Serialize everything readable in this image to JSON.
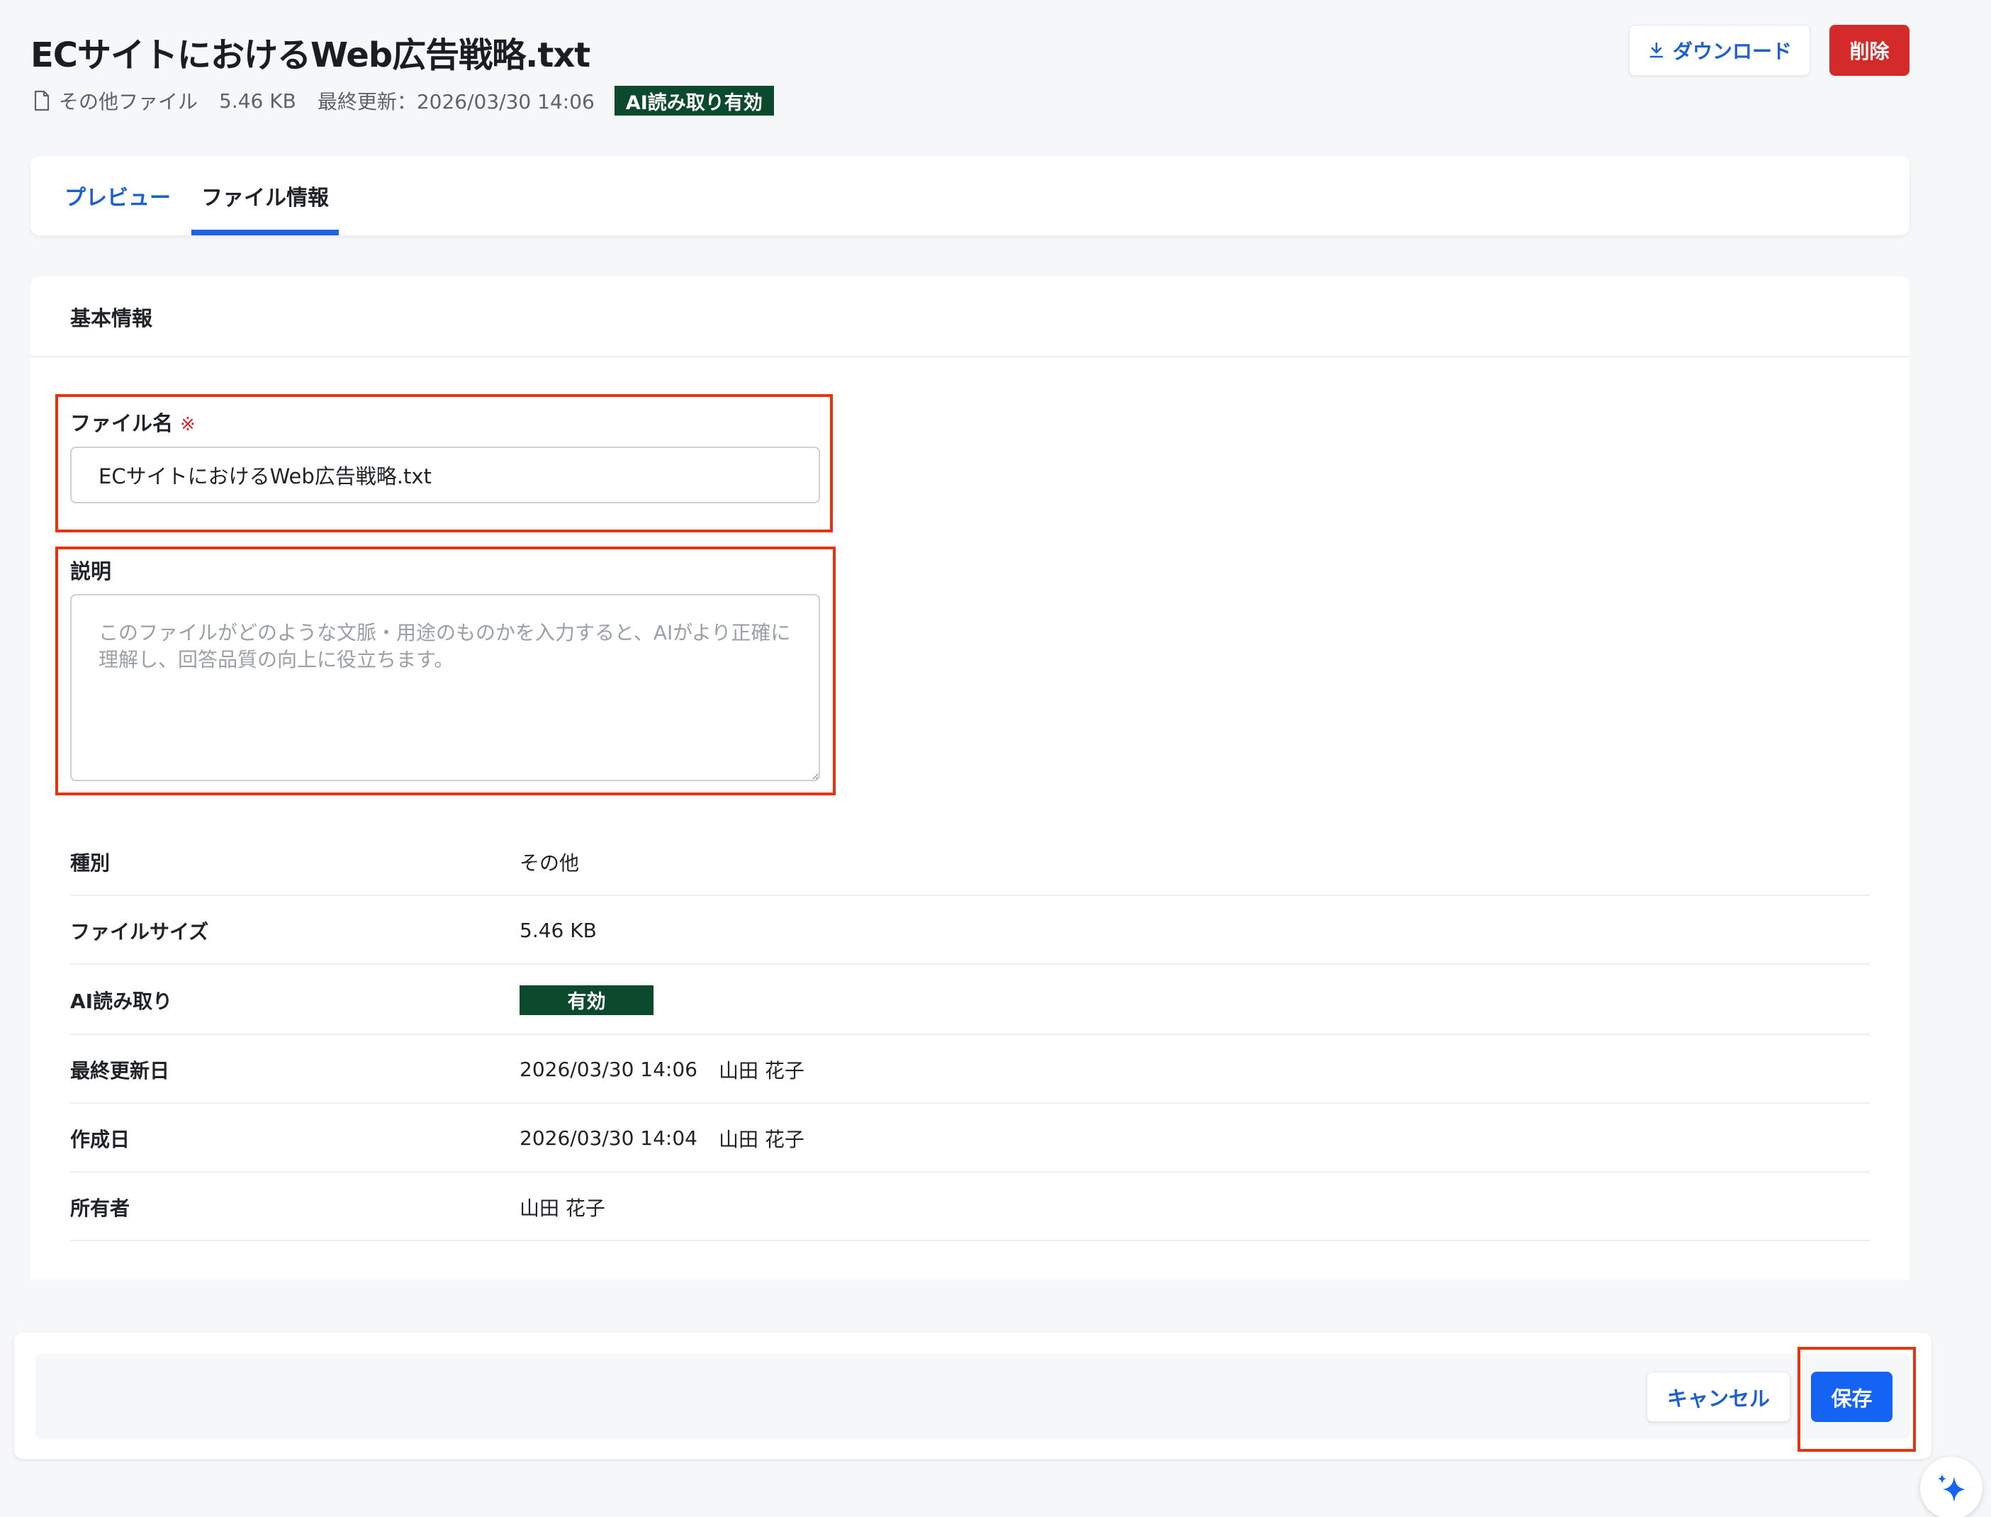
{
  "header": {
    "title": "ECサイトにおけるWeb広告戦略.txt",
    "file_type": "その他ファイル",
    "file_size": "5.46 KB",
    "last_updated": "最終更新：2026/03/30 14:06",
    "ai_badge": "AI読み取り有効",
    "download_label": "ダウンロード",
    "delete_label": "削除"
  },
  "tabs": [
    {
      "label": "プレビュー",
      "active": false
    },
    {
      "label": "ファイル情報",
      "active": true
    }
  ],
  "section": {
    "title": "基本情報"
  },
  "form": {
    "filename_label": "ファイル名",
    "required_mark": "※",
    "filename_value": "ECサイトにおけるWeb広告戦略.txt",
    "description_label": "説明",
    "description_placeholder": "このファイルがどのような文脈・用途のものかを入力すると、AIがより正確に理解し、回答品質の向上に役立ちます。",
    "description_value": ""
  },
  "info": {
    "type_label": "種別",
    "type_value": "その他",
    "size_label": "ファイルサイズ",
    "size_value": "5.46 KB",
    "ai_label": "AI読み取り",
    "ai_value": "有効",
    "updated_label": "最終更新日",
    "updated_date": "2026/03/30 14:06",
    "updated_by": "山田 花子",
    "created_label": "作成日",
    "created_date": "2026/03/30 14:04",
    "created_by": "山田 花子",
    "owner_label": "所有者",
    "owner_value": "山田 花子"
  },
  "footer": {
    "cancel_label": "キャンセル",
    "save_label": "保存"
  },
  "colors": {
    "accent": "#1c5fcf",
    "primary_button": "#1463f3",
    "danger": "#d42a2a",
    "ai_badge": "#0c4a2e",
    "highlight": "#e8330f"
  },
  "icons": [
    "file-icon",
    "download-icon",
    "sparkle-icon"
  ]
}
